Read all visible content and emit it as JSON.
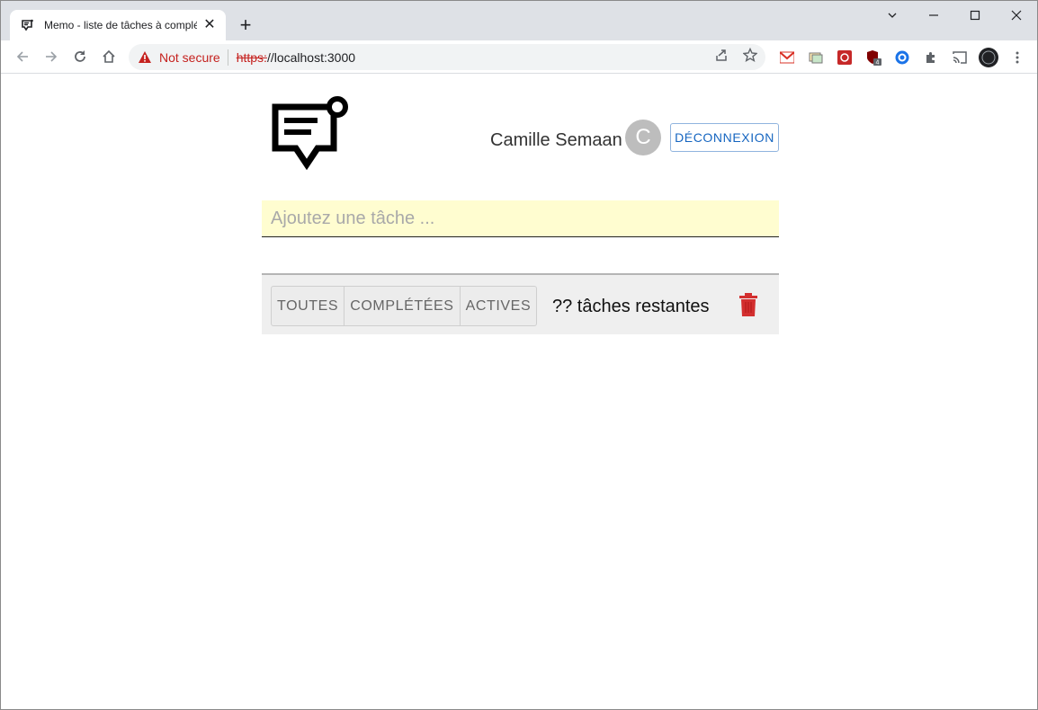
{
  "browser": {
    "tab_title": "Memo - liste de tâches à complé",
    "security_label": "Not secure",
    "url_scheme": "https:",
    "url_rest": "//localhost:3000",
    "extension_badge": "4"
  },
  "header": {
    "user_name": "Camille Semaan",
    "avatar_letter": "C",
    "logout_label": "DÉCONNEXION"
  },
  "task_input": {
    "placeholder": "Ajoutez une tâche ...",
    "value": ""
  },
  "footer": {
    "filters": [
      "TOUTES",
      "COMPLÉTÉES",
      "ACTIVES"
    ],
    "remaining_text": "?? tâches restantes"
  },
  "colors": {
    "accent": "#1565c0",
    "danger": "#d32f2f",
    "input_bg": "#fffdd0"
  }
}
